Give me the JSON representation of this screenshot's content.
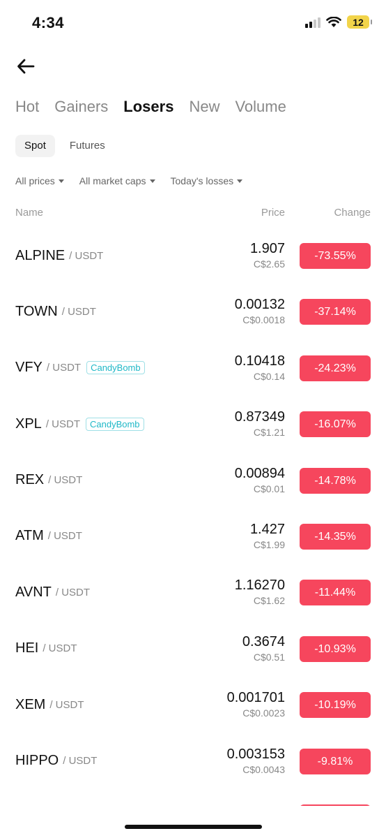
{
  "status": {
    "time": "4:34",
    "battery": "12",
    "battery_color": "#f2d44a",
    "icons": [
      "cellular-signal-icon",
      "wifi-icon",
      "battery-icon"
    ]
  },
  "nav": {
    "back_icon": "arrow-left-icon"
  },
  "tabs": [
    {
      "label": "Hot",
      "active": false
    },
    {
      "label": "Gainers",
      "active": false
    },
    {
      "label": "Losers",
      "active": true
    },
    {
      "label": "New",
      "active": false
    },
    {
      "label": "Volume",
      "active": false
    }
  ],
  "segments": [
    {
      "label": "Spot",
      "active": true
    },
    {
      "label": "Futures",
      "active": false
    }
  ],
  "filters": [
    {
      "label": "All prices"
    },
    {
      "label": "All market caps"
    },
    {
      "label": "Today's losses"
    }
  ],
  "columns": {
    "name": "Name",
    "price": "Price",
    "change": "Change"
  },
  "colors": {
    "loss": "#f6465d",
    "tag": "#1fb8c7"
  },
  "rows": [
    {
      "base": "ALPINE",
      "quote": "/ USDT",
      "tag": "",
      "price": "1.907",
      "fiat": "C$2.65",
      "change": "-73.55%"
    },
    {
      "base": "TOWN",
      "quote": "/ USDT",
      "tag": "",
      "price": "0.00132",
      "fiat": "C$0.0018",
      "change": "-37.14%"
    },
    {
      "base": "VFY",
      "quote": "/ USDT",
      "tag": "CandyBomb",
      "price": "0.10418",
      "fiat": "C$0.14",
      "change": "-24.23%"
    },
    {
      "base": "XPL",
      "quote": "/ USDT",
      "tag": "CandyBomb",
      "price": "0.87349",
      "fiat": "C$1.21",
      "change": "-16.07%"
    },
    {
      "base": "REX",
      "quote": "/ USDT",
      "tag": "",
      "price": "0.00894",
      "fiat": "C$0.01",
      "change": "-14.78%"
    },
    {
      "base": "ATM",
      "quote": "/ USDT",
      "tag": "",
      "price": "1.427",
      "fiat": "C$1.99",
      "change": "-14.35%"
    },
    {
      "base": "AVNT",
      "quote": "/ USDT",
      "tag": "",
      "price": "1.16270",
      "fiat": "C$1.62",
      "change": "-11.44%"
    },
    {
      "base": "HEI",
      "quote": "/ USDT",
      "tag": "",
      "price": "0.3674",
      "fiat": "C$0.51",
      "change": "-10.93%"
    },
    {
      "base": "XEM",
      "quote": "/ USDT",
      "tag": "",
      "price": "0.001701",
      "fiat": "C$0.0023",
      "change": "-10.19%"
    },
    {
      "base": "HIPPO",
      "quote": "/ USDT",
      "tag": "",
      "price": "0.003153",
      "fiat": "C$0.0043",
      "change": "-9.81%"
    }
  ]
}
